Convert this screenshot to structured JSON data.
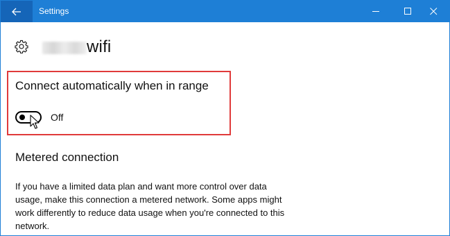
{
  "window": {
    "title": "Settings"
  },
  "header": {
    "network_name": "wifi"
  },
  "auto_connect": {
    "title": "Connect automatically when in range",
    "toggle_state": "Off"
  },
  "metered": {
    "title": "Metered connection",
    "description": "If you have a limited data plan and want more control over data usage, make this connection a metered network. Some apps might work differently to reduce data usage when you're connected to this network."
  },
  "icons": [
    "back-arrow-icon",
    "minimize-icon",
    "maximize-icon",
    "close-icon",
    "gear-icon",
    "mouse-cursor-icon"
  ],
  "colors": {
    "titlebar": "#1e7fd6",
    "back_button": "#1565b8",
    "highlight_border": "#e03a3a"
  }
}
